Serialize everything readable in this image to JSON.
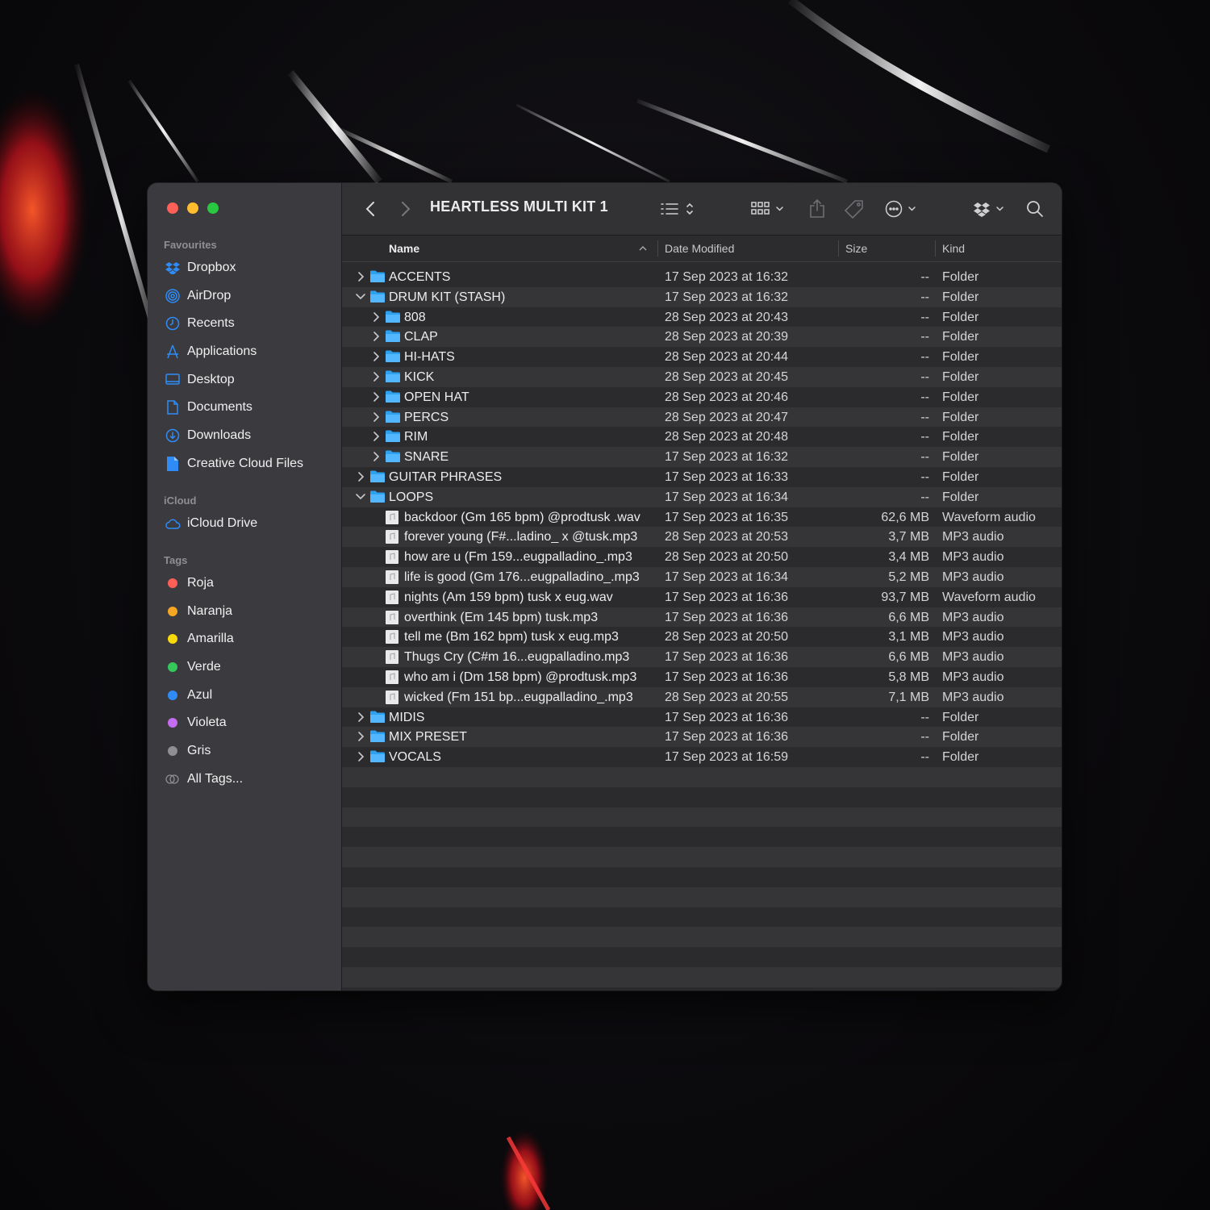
{
  "window": {
    "title": "HEARTLESS MULTI KIT 1"
  },
  "sidebar": {
    "favourites_title": "Favourites",
    "favourites": [
      {
        "label": "Dropbox",
        "icon": "dropbox-icon"
      },
      {
        "label": "AirDrop",
        "icon": "airdrop-icon"
      },
      {
        "label": "Recents",
        "icon": "clock-icon"
      },
      {
        "label": "Applications",
        "icon": "applications-icon"
      },
      {
        "label": "Desktop",
        "icon": "desktop-icon"
      },
      {
        "label": "Documents",
        "icon": "document-icon"
      },
      {
        "label": "Downloads",
        "icon": "download-icon"
      },
      {
        "label": "Creative Cloud Files",
        "icon": "file-icon"
      }
    ],
    "icloud_title": "iCloud",
    "icloud": [
      {
        "label": "iCloud Drive",
        "icon": "cloud-icon"
      }
    ],
    "tags_title": "Tags",
    "tags": [
      {
        "label": "Roja",
        "color": "#fe5f57"
      },
      {
        "label": "Naranja",
        "color": "#f5a623"
      },
      {
        "label": "Amarilla",
        "color": "#f5d90a"
      },
      {
        "label": "Verde",
        "color": "#34c759"
      },
      {
        "label": "Azul",
        "color": "#2f8cf7"
      },
      {
        "label": "Violeta",
        "color": "#c66cf0"
      },
      {
        "label": "Gris",
        "color": "#8e8e93"
      },
      {
        "label": "All Tags...",
        "color": ""
      }
    ]
  },
  "columns": {
    "name": "Name",
    "date": "Date Modified",
    "size": "Size",
    "kind": "Kind"
  },
  "rows": [
    {
      "name": "ACCENTS",
      "date": "17 Sep 2023 at 16:32",
      "size": "--",
      "kind": "Folder",
      "level": 0,
      "type": "folder",
      "expanded": false
    },
    {
      "name": "DRUM KIT (STASH)",
      "date": "17 Sep 2023 at 16:32",
      "size": "--",
      "kind": "Folder",
      "level": 0,
      "type": "folder",
      "expanded": true
    },
    {
      "name": "808",
      "date": "28 Sep 2023 at 20:43",
      "size": "--",
      "kind": "Folder",
      "level": 1,
      "type": "folder",
      "expanded": false
    },
    {
      "name": "CLAP",
      "date": "28 Sep 2023 at 20:39",
      "size": "--",
      "kind": "Folder",
      "level": 1,
      "type": "folder",
      "expanded": false
    },
    {
      "name": "HI-HATS",
      "date": "28 Sep 2023 at 20:44",
      "size": "--",
      "kind": "Folder",
      "level": 1,
      "type": "folder",
      "expanded": false
    },
    {
      "name": "KICK",
      "date": "28 Sep 2023 at 20:45",
      "size": "--",
      "kind": "Folder",
      "level": 1,
      "type": "folder",
      "expanded": false
    },
    {
      "name": "OPEN HAT",
      "date": "28 Sep 2023 at 20:46",
      "size": "--",
      "kind": "Folder",
      "level": 1,
      "type": "folder",
      "expanded": false
    },
    {
      "name": "PERCS",
      "date": "28 Sep 2023 at 20:47",
      "size": "--",
      "kind": "Folder",
      "level": 1,
      "type": "folder",
      "expanded": false
    },
    {
      "name": "RIM",
      "date": "28 Sep 2023 at 20:48",
      "size": "--",
      "kind": "Folder",
      "level": 1,
      "type": "folder",
      "expanded": false
    },
    {
      "name": "SNARE",
      "date": "17 Sep 2023 at 16:32",
      "size": "--",
      "kind": "Folder",
      "level": 1,
      "type": "folder",
      "expanded": false
    },
    {
      "name": "GUITAR PHRASES",
      "date": "17 Sep 2023 at 16:33",
      "size": "--",
      "kind": "Folder",
      "level": 0,
      "type": "folder",
      "expanded": false
    },
    {
      "name": "LOOPS",
      "date": "17 Sep 2023 at 16:34",
      "size": "--",
      "kind": "Folder",
      "level": 0,
      "type": "folder",
      "expanded": true
    },
    {
      "name": "backdoor (Gm 165 bpm) @prodtusk .wav",
      "date": "17 Sep 2023 at 16:35",
      "size": "62,6 MB",
      "kind": "Waveform audio",
      "level": 1,
      "type": "file"
    },
    {
      "name": "forever young (F#...ladino_ x @tusk.mp3",
      "date": "28 Sep 2023 at 20:53",
      "size": "3,7 MB",
      "kind": "MP3 audio",
      "level": 1,
      "type": "file"
    },
    {
      "name": "how are u (Fm 159...eugpalladino_.mp3",
      "date": "28 Sep 2023 at 20:50",
      "size": "3,4 MB",
      "kind": "MP3 audio",
      "level": 1,
      "type": "file"
    },
    {
      "name": "life is good (Gm 176...eugpalladino_.mp3",
      "date": "17 Sep 2023 at 16:34",
      "size": "5,2 MB",
      "kind": "MP3 audio",
      "level": 1,
      "type": "file"
    },
    {
      "name": "nights (Am 159 bpm) tusk x eug.wav",
      "date": "17 Sep 2023 at 16:36",
      "size": "93,7 MB",
      "kind": "Waveform audio",
      "level": 1,
      "type": "file"
    },
    {
      "name": "overthink (Em 145 bpm) tusk.mp3",
      "date": "17 Sep 2023 at 16:36",
      "size": "6,6 MB",
      "kind": "MP3 audio",
      "level": 1,
      "type": "file"
    },
    {
      "name": "tell me (Bm 162 bpm) tusk x eug.mp3",
      "date": "28 Sep 2023 at 20:50",
      "size": "3,1 MB",
      "kind": "MP3 audio",
      "level": 1,
      "type": "file"
    },
    {
      "name": "Thugs Cry (C#m 16...eugpalladino.mp3",
      "date": "17 Sep 2023 at 16:36",
      "size": "6,6 MB",
      "kind": "MP3 audio",
      "level": 1,
      "type": "file"
    },
    {
      "name": "who am i (Dm 158 bpm) @prodtusk.mp3",
      "date": "17 Sep 2023 at 16:36",
      "size": "5,8 MB",
      "kind": "MP3 audio",
      "level": 1,
      "type": "file"
    },
    {
      "name": "wicked (Fm 151 bp...eugpalladino_.mp3",
      "date": "28 Sep 2023 at 20:55",
      "size": "7,1 MB",
      "kind": "MP3 audio",
      "level": 1,
      "type": "file"
    },
    {
      "name": "MIDIS",
      "date": "17 Sep 2023 at 16:36",
      "size": "--",
      "kind": "Folder",
      "level": 0,
      "type": "folder",
      "expanded": false
    },
    {
      "name": "MIX PRESET",
      "date": "17 Sep 2023 at 16:36",
      "size": "--",
      "kind": "Folder",
      "level": 0,
      "type": "folder",
      "expanded": false
    },
    {
      "name": "VOCALS",
      "date": "17 Sep 2023 at 16:59",
      "size": "--",
      "kind": "Folder",
      "level": 0,
      "type": "folder",
      "expanded": false
    }
  ],
  "colors": {
    "folder": "#2ea0f0",
    "accent": "#1e90ff"
  }
}
